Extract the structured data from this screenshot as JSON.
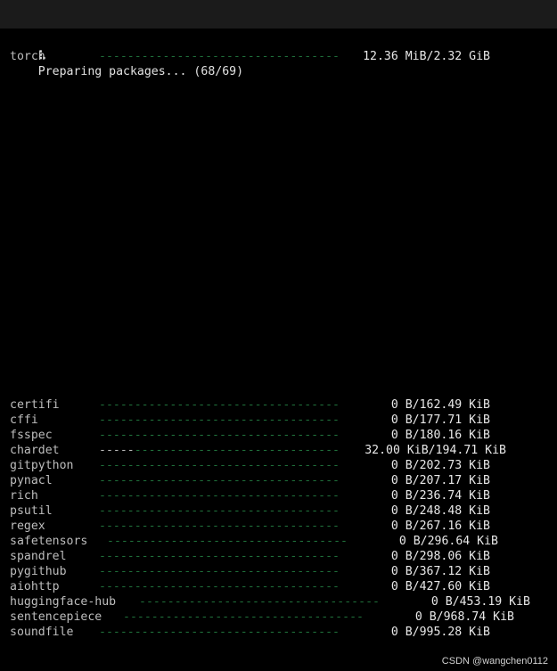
{
  "window": {
    "title": ""
  },
  "status": {
    "spinner": "⠧",
    "text": "Preparing packages... (68/69)"
  },
  "active_downloads": [
    {
      "name": "torch",
      "progress": 0.005,
      "size": "12.36 MiB/2.32 GiB"
    }
  ],
  "queued_downloads": [
    {
      "name": "certifi",
      "progress": 0.0,
      "size": "0 B/162.49 KiB"
    },
    {
      "name": "cffi",
      "progress": 0.0,
      "size": "0 B/177.71 KiB"
    },
    {
      "name": "fsspec",
      "progress": 0.0,
      "size": "0 B/180.16 KiB"
    },
    {
      "name": "chardet",
      "progress": 0.16,
      "size": "32.00 KiB/194.71 KiB"
    },
    {
      "name": "gitpython",
      "progress": 0.0,
      "size": "0 B/202.73 KiB"
    },
    {
      "name": "pynacl",
      "progress": 0.0,
      "size": "0 B/207.17 KiB"
    },
    {
      "name": "rich",
      "progress": 0.0,
      "size": "0 B/236.74 KiB"
    },
    {
      "name": "psutil",
      "progress": 0.0,
      "size": "0 B/248.48 KiB"
    },
    {
      "name": "regex",
      "progress": 0.0,
      "size": "0 B/267.16 KiB"
    },
    {
      "name": "safetensors",
      "progress": 0.0,
      "size": "0 B/296.64 KiB"
    },
    {
      "name": "spandrel",
      "progress": 0.0,
      "size": "0 B/298.06 KiB"
    },
    {
      "name": "pygithub",
      "progress": 0.0,
      "size": "0 B/367.12 KiB"
    },
    {
      "name": "aiohttp",
      "progress": 0.0,
      "size": "0 B/427.60 KiB"
    },
    {
      "name": "huggingface-hub",
      "progress": 0.0,
      "size": "0 B/453.19 KiB"
    },
    {
      "name": "sentencepiece",
      "progress": 0.0,
      "size": "0 B/968.74 KiB"
    },
    {
      "name": "soundfile",
      "progress": 0.0,
      "size": "0 B/995.28 KiB"
    }
  ],
  "watermark": "CSDN @wangchen0112",
  "colors": {
    "background": "#000000",
    "titlebar": "#1b1b1b",
    "bar_empty": "#1f6f3a",
    "bar_filled": "#b8b8b8",
    "text": "#e8e8e8"
  }
}
